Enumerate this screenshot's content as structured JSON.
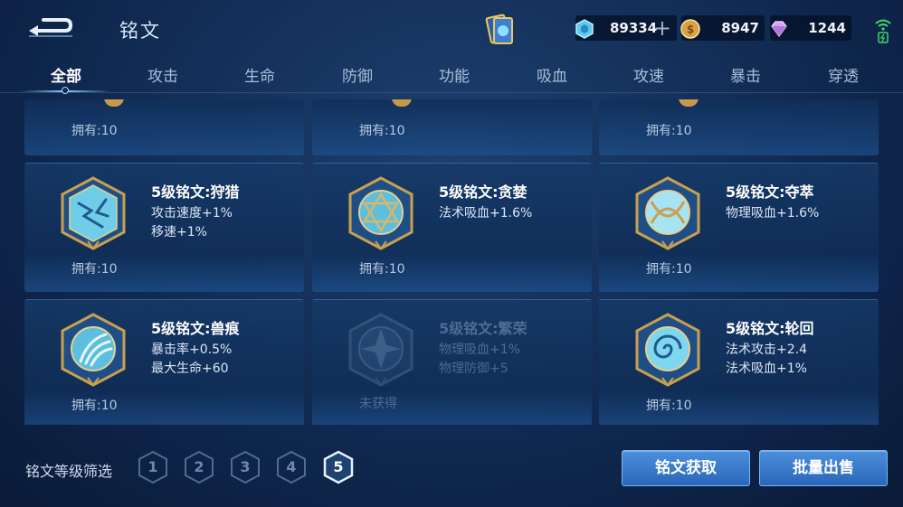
{
  "header": {
    "title": "铭文",
    "currencies": [
      {
        "name": "diamond-coupon",
        "amount": "89334"
      },
      {
        "name": "gold-coin",
        "amount": "8947"
      },
      {
        "name": "gem",
        "amount": "1244"
      }
    ]
  },
  "tabs": [
    {
      "label": "全部",
      "active": true
    },
    {
      "label": "攻击"
    },
    {
      "label": "生命"
    },
    {
      "label": "防御"
    },
    {
      "label": "功能"
    },
    {
      "label": "吸血"
    },
    {
      "label": "攻速"
    },
    {
      "label": "暴击"
    },
    {
      "label": "穿透"
    }
  ],
  "partial_row": [
    {
      "owned": "拥有:10"
    },
    {
      "owned": "拥有:10"
    },
    {
      "owned": "拥有:10"
    }
  ],
  "cards": [
    {
      "name": "5级铭文:狩猎",
      "stats": [
        "攻击速度+1%",
        "移速+1%"
      ],
      "owned": "拥有:10",
      "icon": "lightning-rune-icon"
    },
    {
      "name": "5级铭文:贪婪",
      "stats": [
        "法术吸血+1.6%"
      ],
      "owned": "拥有:10",
      "icon": "hexagram-rune-icon"
    },
    {
      "name": "5级铭文:夺萃",
      "stats": [
        "物理吸血+1.6%"
      ],
      "owned": "拥有:10",
      "icon": "knot-rune-icon"
    },
    {
      "name": "5级铭文:兽痕",
      "stats": [
        "暴击率+0.5%",
        "最大生命+60"
      ],
      "owned": "拥有:10",
      "icon": "claw-rune-icon"
    },
    {
      "name": "5级铭文:繁荣",
      "stats": [
        "物理吸血+1%",
        "物理防御+5"
      ],
      "owned": "未获得",
      "icon": "flower-rune-icon",
      "locked": true
    },
    {
      "name": "5级铭文:轮回",
      "stats": [
        "法术攻击+2.4",
        "法术吸血+1%"
      ],
      "owned": "拥有:10",
      "icon": "spiral-rune-icon"
    }
  ],
  "footer": {
    "filter_label": "铭文等级筛选",
    "levels": [
      "1",
      "2",
      "3",
      "4",
      "5"
    ],
    "active_level": "5",
    "acquire_label": "铭文获取",
    "sell_label": "批量出售"
  },
  "colors": {
    "accent_gold": "#c9a04e",
    "rune_cyan": "#7fd6ef",
    "button_blue": "#3a7ccc"
  }
}
